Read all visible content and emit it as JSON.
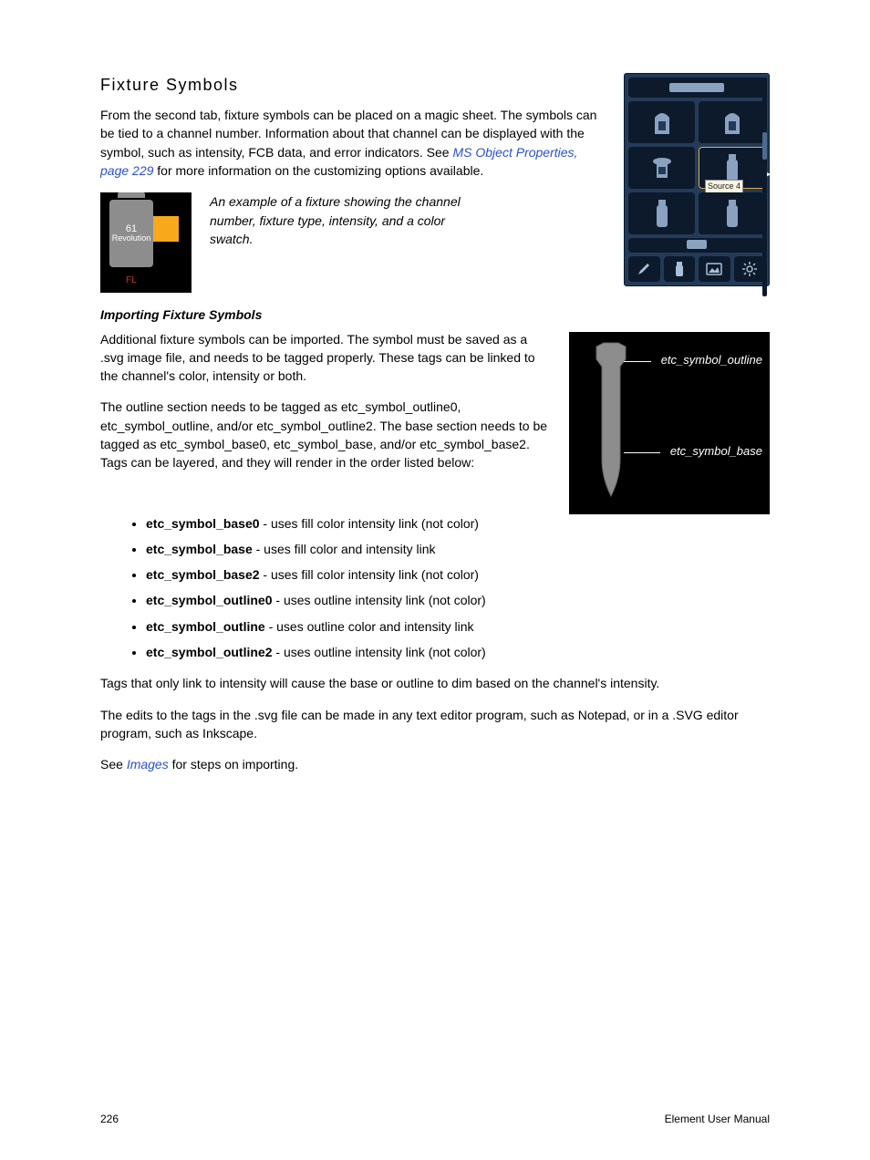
{
  "heading": "Fixture Symbols",
  "intro_a": "From the second tab, fixture symbols can be placed on a magic sheet. The symbols can be tied to a channel number. Information about that channel can be displayed with the symbol, such as intensity, FCB data, and error indicators. See ",
  "intro_link": "MS Object Properties, page 229",
  "intro_b": " for more information on the customizing options available.",
  "example": {
    "channel": "61",
    "type": "Revolution",
    "fl": "FL",
    "caption": "An example of a fixture showing the channel number, fixture type, intensity, and a color swatch."
  },
  "subheading": "Importing Fixture Symbols",
  "para1": "Additional fixture symbols can be imported. The symbol must be saved as a .svg image file, and needs to be tagged properly. These tags can be linked to the channel's color, intensity or both.",
  "para2": "The outline section needs to be tagged as etc_symbol_outline0, etc_symbol_outline, and/or etc_symbol_outline2. The base section needs to be tagged as etc_symbol_base0, etc_symbol_base, and/or etc_symbol_base2. Tags can be layered, and they will render in the order listed below:",
  "tags": [
    {
      "name": "etc_symbol_base0",
      "desc": " - uses fill color intensity link (not color)"
    },
    {
      "name": "etc_symbol_base",
      "desc": " - uses fill color and intensity link"
    },
    {
      "name": "etc_symbol_base2",
      "desc": " - uses fill color intensity link (not color)"
    },
    {
      "name": "etc_symbol_outline0",
      "desc": " - uses outline intensity link (not color)"
    },
    {
      "name": "etc_symbol_outline",
      "desc": " - uses outline color and intensity link"
    },
    {
      "name": "etc_symbol_outline2",
      "desc": " - uses outline intensity link (not color)"
    }
  ],
  "para3": "Tags that only link to intensity will cause the base or outline to dim based on the channel's intensity.",
  "para4": "The edits to the tags in the .svg file can be made in any text editor program, such as Notepad, or in a .SVG editor program, such as Inkscape.",
  "para5a": "See ",
  "para5link": "Images",
  "para5b": " for steps on importing.",
  "diagram": {
    "label_outline": "etc_symbol_outline",
    "label_base": "etc_symbol_base"
  },
  "panel_tooltip": "Source 4",
  "footer": {
    "page": "226",
    "manual": "Element User Manual"
  }
}
